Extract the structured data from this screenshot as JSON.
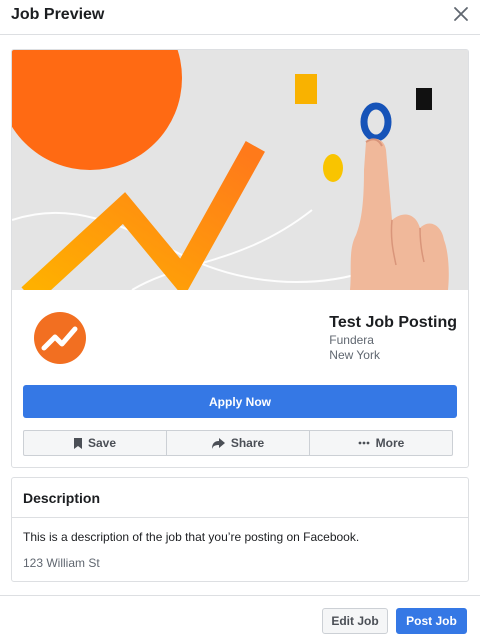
{
  "header": {
    "title": "Job Preview",
    "close_icon": "close-icon"
  },
  "job": {
    "title": "Test Job Posting",
    "company": "Fundera",
    "location": "New York",
    "apply_label": "Apply Now",
    "actions": [
      {
        "label": "Save",
        "icon": "bookmark-icon"
      },
      {
        "label": "Share",
        "icon": "share-arrow-icon"
      },
      {
        "label": "More",
        "icon": "ellipsis-icon"
      }
    ]
  },
  "description": {
    "heading": "Description",
    "text": "This is a description of the job that you’re posting on Facebook.",
    "address": "123 William St"
  },
  "footer": {
    "edit_label": "Edit Job",
    "post_label": "Post Job"
  },
  "colors": {
    "primary": "#3578e5",
    "brand_orange": "#f26f21",
    "banner_bg": "#e3e3e3",
    "accent_yellow": "#f9b200",
    "accent_blue": "#1653b8"
  }
}
